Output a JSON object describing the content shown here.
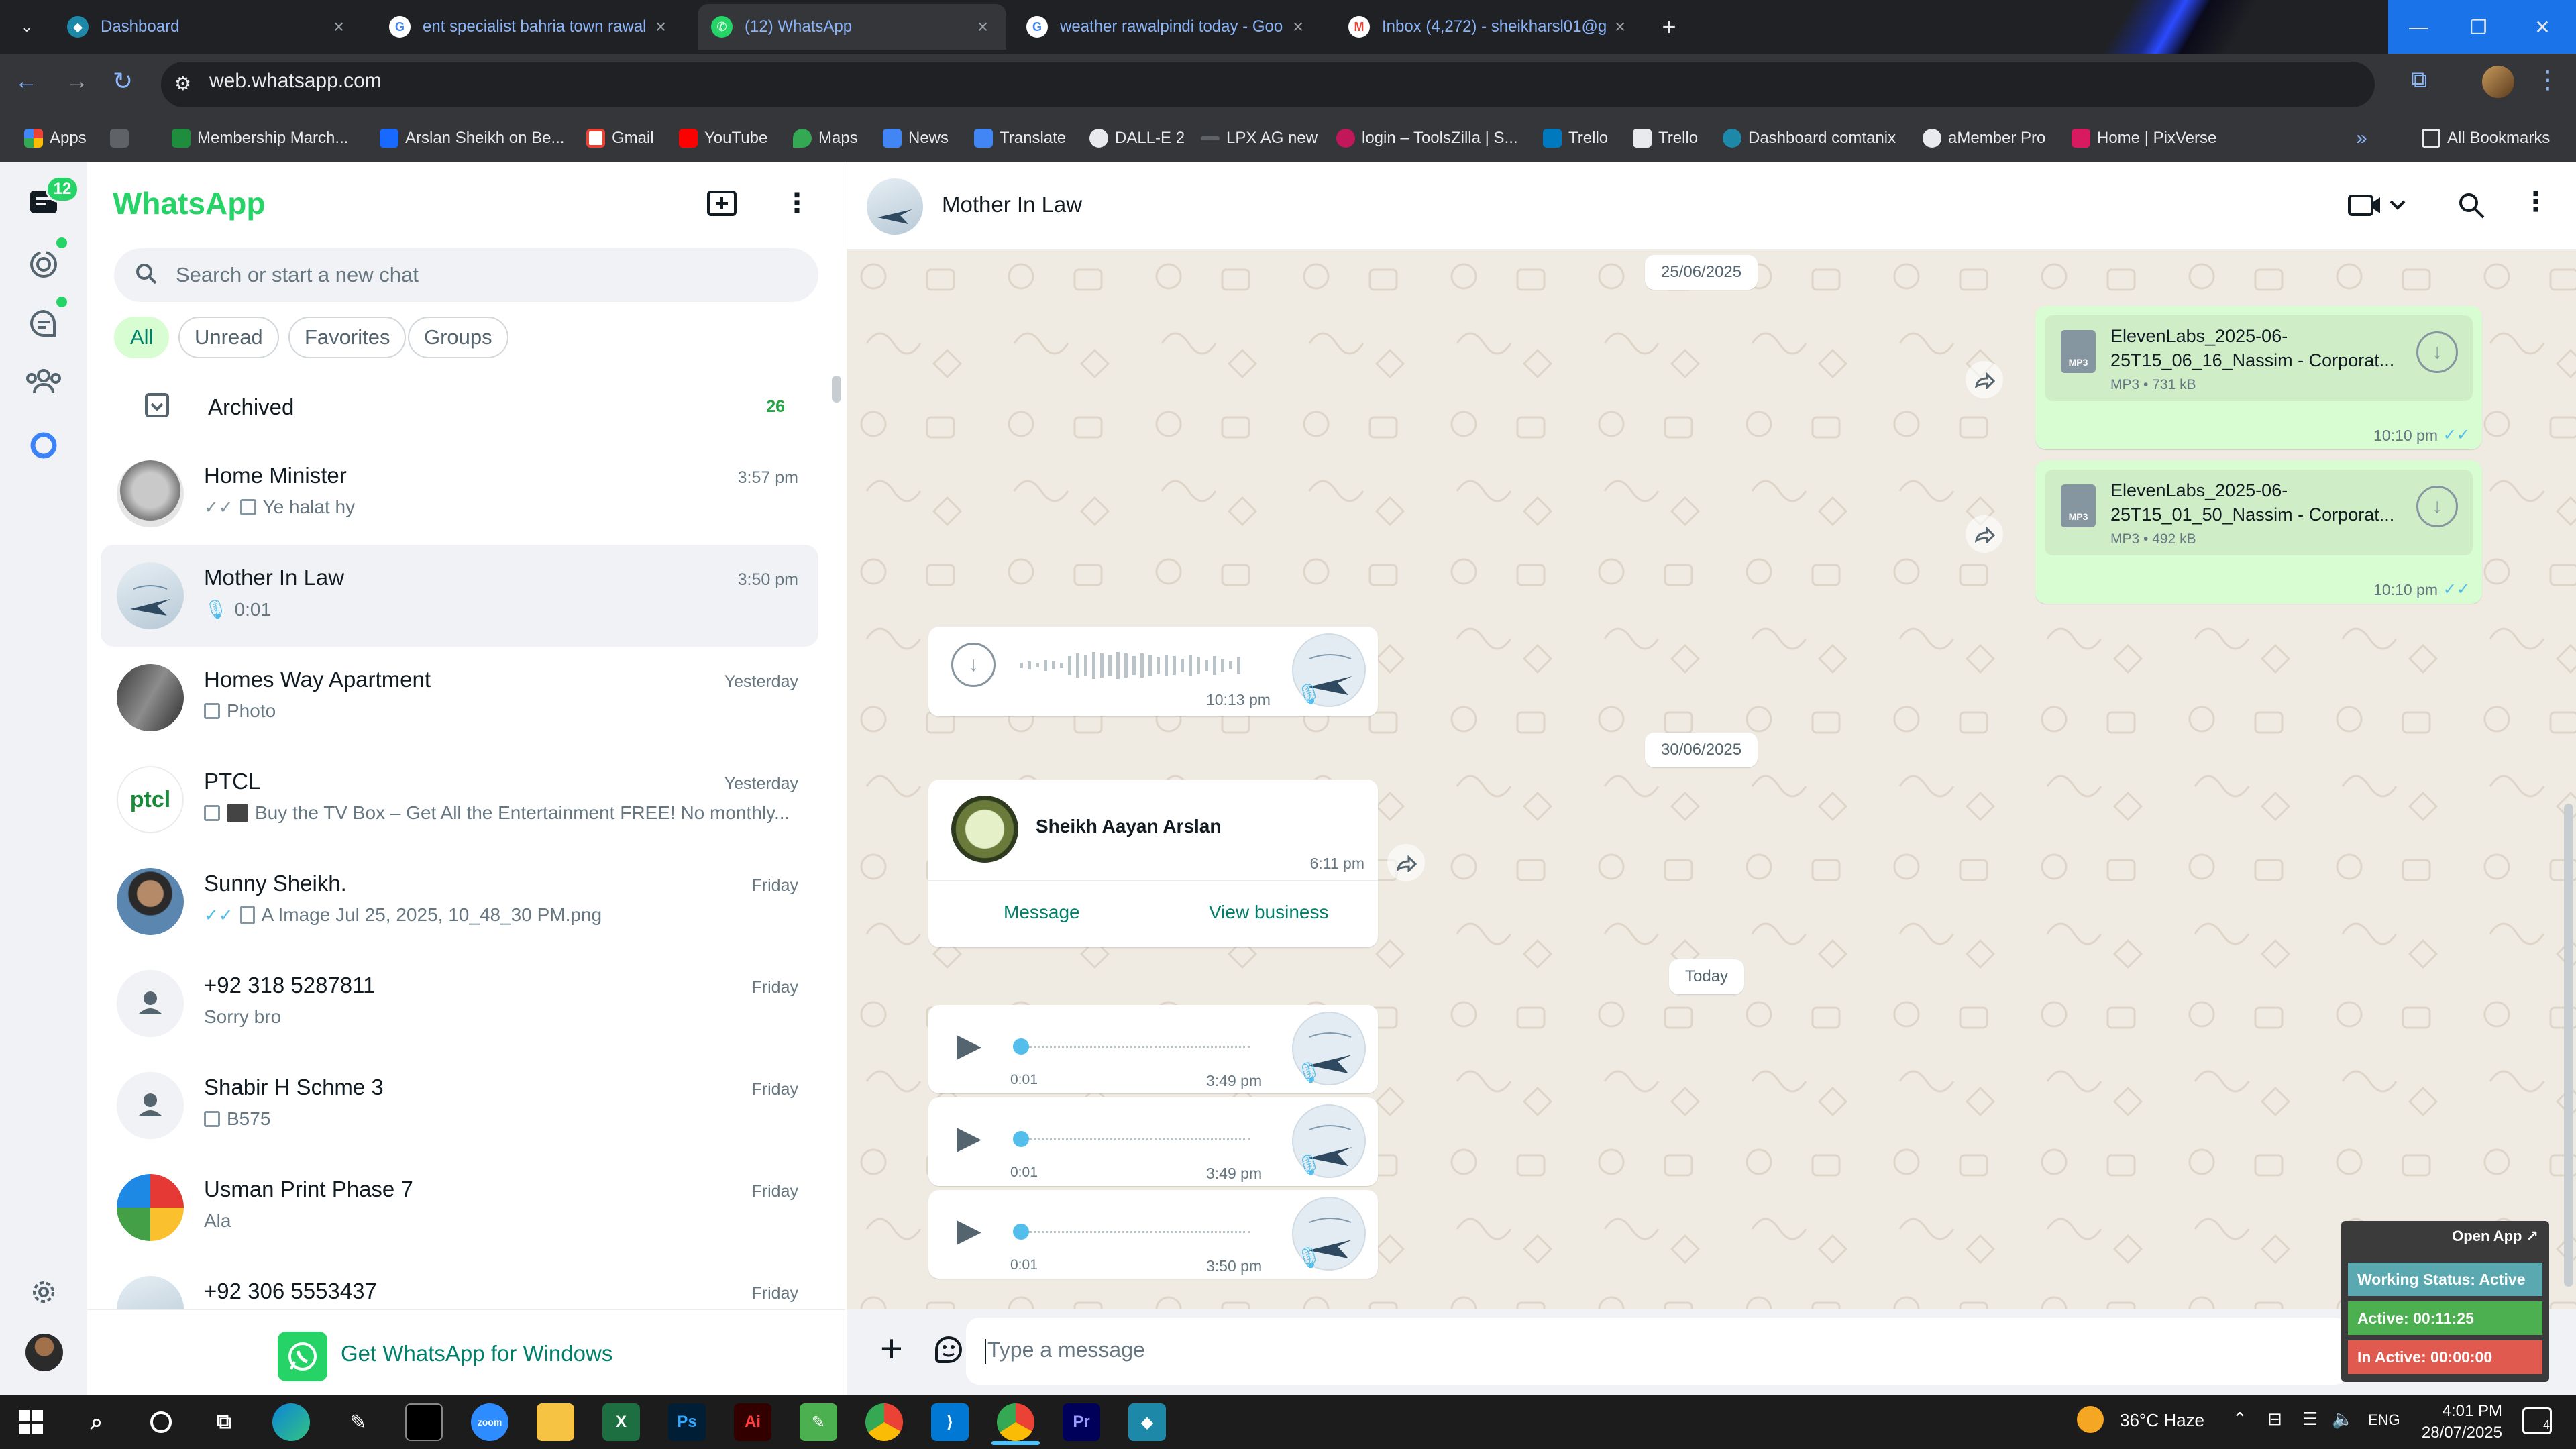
{
  "browser": {
    "tabs": [
      {
        "title": "Dashboard",
        "active": false
      },
      {
        "title": "ent specialist bahria town rawal",
        "active": false
      },
      {
        "title": "(12) WhatsApp",
        "active": true
      },
      {
        "title": "weather rawalpindi today - Goo",
        "active": false
      },
      {
        "title": "Inbox (4,272) - sheikharsl01@g",
        "active": false
      }
    ],
    "url": "web.whatsapp.com",
    "bookmarks": [
      "Apps",
      "Membership March...",
      "Arslan Sheikh on Be...",
      "Gmail",
      "YouTube",
      "Maps",
      "News",
      "Translate",
      "DALL-E 2",
      "LPX AG new",
      "login – ToolsZilla | S...",
      "Trello",
      "Trello",
      "Dashboard comtanix",
      "aMember Pro",
      "Home | PixVerse"
    ],
    "all_bookmarks": "All Bookmarks"
  },
  "rail": {
    "unread_badge": "12"
  },
  "sidebar": {
    "title": "WhatsApp",
    "search_placeholder": "Search or start a new chat",
    "filters": [
      "All",
      "Unread",
      "Favorites",
      "Groups"
    ],
    "archived_label": "Archived",
    "archived_count": "26",
    "chats": [
      {
        "name": "Home Minister",
        "time": "3:57 pm",
        "last": "Ye halat hy",
        "ticks": "grey",
        "media": "image"
      },
      {
        "name": "Mother In Law",
        "time": "3:50 pm",
        "last": "0:01",
        "ticks": "",
        "media": "mic"
      },
      {
        "name": "Homes Way Apartment",
        "time": "Yesterday",
        "last": "Photo",
        "ticks": "",
        "media": "image"
      },
      {
        "name": "PTCL",
        "time": "Yesterday",
        "last": "Buy the TV Box – Get All the Entertainment FREE! No monthly...",
        "ticks": "",
        "media": "image"
      },
      {
        "name": "Sunny Sheikh.",
        "time": "Friday",
        "last": "A Image Jul 25, 2025, 10_48_30 PM.png",
        "ticks": "blue",
        "media": "doc"
      },
      {
        "name": "+92 318 5287811",
        "time": "Friday",
        "last": "Sorry bro",
        "ticks": "",
        "media": ""
      },
      {
        "name": "Shabir H  Schme 3",
        "time": "Friday",
        "last": "B575",
        "ticks": "",
        "media": "image"
      },
      {
        "name": "Usman Print Phase 7",
        "time": "Friday",
        "last": "Ala",
        "ticks": "",
        "media": ""
      },
      {
        "name": "+92 306 5553437",
        "time": "Friday",
        "last": "",
        "ticks": "",
        "media": ""
      }
    ],
    "get_app": "Get WhatsApp for Windows"
  },
  "conversation": {
    "contact": "Mother In Law",
    "dates": [
      "25/06/2025",
      "30/06/2025",
      "Today"
    ],
    "docs": [
      {
        "name_line1": "ElevenLabs_2025-06-",
        "name_line2": "25T15_06_16_Nassim - Corporat...",
        "meta": "MP3 • 731 kB",
        "type": "MP3",
        "time": "10:10 pm"
      },
      {
        "name_line1": "ElevenLabs_2025-06-",
        "name_line2": "25T15_01_50_Nassim - Corporat...",
        "meta": "MP3 • 492 kB",
        "type": "MP3",
        "time": "10:10 pm"
      }
    ],
    "voice_received_time": "10:13 pm",
    "contact_card": {
      "name": "Sheikh Aayan Arslan",
      "time": "6:11 pm",
      "action1": "Message",
      "action2": "View business"
    },
    "voice_notes": [
      {
        "duration": "0:01",
        "time": "3:49 pm"
      },
      {
        "duration": "0:01",
        "time": "3:49 pm"
      },
      {
        "duration": "0:01",
        "time": "3:50 pm"
      }
    ],
    "composer_placeholder": "Type a message"
  },
  "work_widget": {
    "open_app": "Open App ↗",
    "status": "Working Status: Active",
    "active": "Active: 00:11:25",
    "inactive": "In Active: 00:00:00"
  },
  "taskbar": {
    "weather": "36°C  Haze",
    "lang": "ENG",
    "time": "4:01 PM",
    "date": "28/07/2025",
    "notif_count": "4"
  },
  "colors": {
    "wa_green": "#25d366",
    "wa_teal": "#008069",
    "bubble_out": "#d9fdd3",
    "tick_blue": "#53bdeb"
  }
}
